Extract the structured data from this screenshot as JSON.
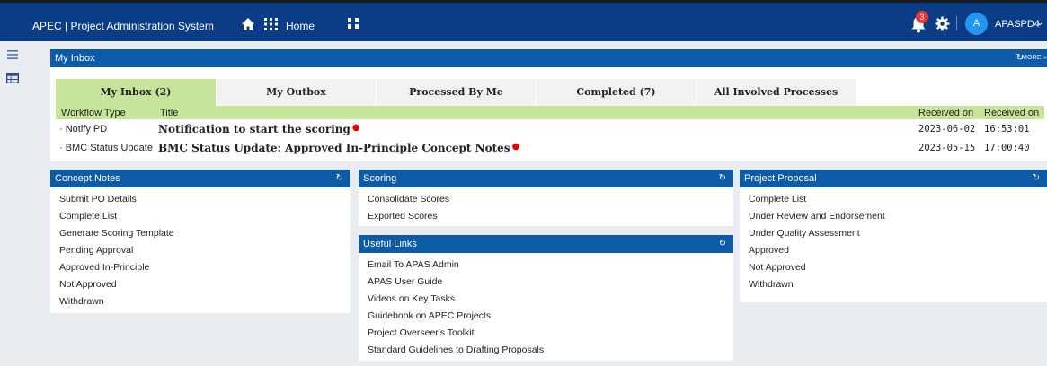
{
  "header": {
    "app_title": "APEC | Project Administration System",
    "home_label": "Home",
    "notification_count": "3",
    "avatar_initial": "A",
    "username": "APASPD4",
    "icons": [
      "home-icon",
      "apps-grid-icon",
      "org-chart-icon",
      "bell-icon",
      "gear-icon",
      "chevron-down-icon"
    ],
    "brand_color": "#0a3d86"
  },
  "sidebar": {
    "icons": [
      "menu-icon",
      "list-icon"
    ]
  },
  "inbox": {
    "title": "My Inbox",
    "more_label": "MORE",
    "tabs": [
      {
        "label": "My Inbox (2)",
        "active": true
      },
      {
        "label": "My Outbox",
        "active": false
      },
      {
        "label": "Processed By Me",
        "active": false
      },
      {
        "label": "Completed (7)",
        "active": false
      },
      {
        "label": "All Involved Processes",
        "active": false
      }
    ],
    "columns": [
      "Workflow Type",
      "Title",
      "Received on",
      "Received on"
    ],
    "rows": [
      {
        "type": "· Notify PD",
        "title": "Notification to start the scoring",
        "date": "2023-06-02",
        "time": "16:53:01"
      },
      {
        "type": "· BMC Status Update",
        "title": "BMC Status Update: Approved In-Principle Concept Notes",
        "date": "2023-05-15",
        "time": "17:00:40"
      }
    ],
    "accent_color": "#c6e59a"
  },
  "concept_notes": {
    "title": "Concept Notes",
    "items": [
      "Submit PO Details",
      "Complete List",
      "Generate Scoring Template",
      "Pending Approval",
      "Approved In-Principle",
      "Not Approved",
      "Withdrawn"
    ]
  },
  "scoring": {
    "title": "Scoring",
    "items": [
      "Consolidate Scores",
      "Exported Scores"
    ]
  },
  "useful_links": {
    "title": "Useful Links",
    "items": [
      "Email To APAS Admin",
      "APAS User Guide",
      "Videos on Key Tasks",
      "Guidebook on APEC Projects",
      "Project Overseer's Toolkit",
      "Standard Guidelines to Drafting Proposals"
    ]
  },
  "project_proposal": {
    "title": "Project Proposal",
    "items": [
      "Complete List",
      "Under Review and Endorsement",
      "Under Quality Assessment",
      "Approved",
      "Not Approved",
      "Withdrawn"
    ]
  }
}
